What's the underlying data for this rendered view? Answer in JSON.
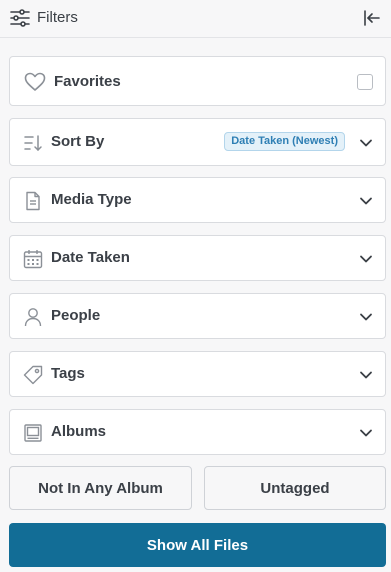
{
  "header": {
    "title": "Filters",
    "icon": "sliders-icon",
    "collapse_icon": "collapse-left-icon"
  },
  "favorites": {
    "label": "Favorites",
    "checked": false,
    "icon": "heart-icon"
  },
  "sections": [
    {
      "label": "Sort By",
      "icon": "sort-icon",
      "badge": "Date Taken (Newest)"
    },
    {
      "label": "Media Type",
      "icon": "document-icon"
    },
    {
      "label": "Date Taken",
      "icon": "calendar-icon"
    },
    {
      "label": "People",
      "icon": "person-icon"
    },
    {
      "label": "Tags",
      "icon": "tag-icon"
    },
    {
      "label": "Albums",
      "icon": "album-icon"
    }
  ],
  "buttons": {
    "not_in_album": "Not In Any Album",
    "untagged": "Untagged",
    "show_all": "Show All Files"
  },
  "colors": {
    "primary": "#126d96",
    "badge_text": "#2f7fb4",
    "badge_bg": "#e4f1f9",
    "icon": "#8b9097"
  }
}
